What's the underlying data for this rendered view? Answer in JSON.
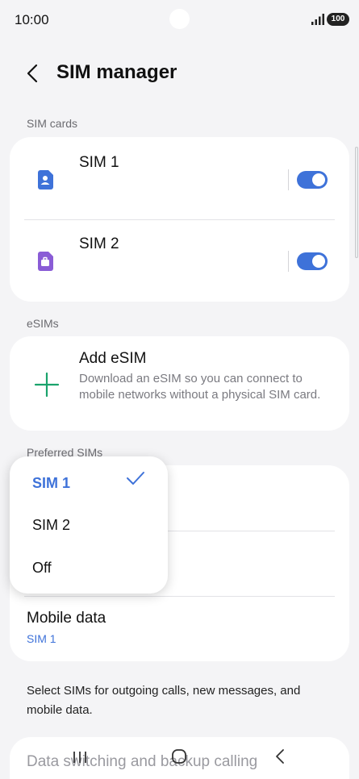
{
  "status_bar": {
    "time": "10:00",
    "battery": "100"
  },
  "header": {
    "title": "SIM manager"
  },
  "sections": {
    "sim_cards": "SIM cards",
    "esims": "eSIMs",
    "preferred": "Preferred SIMs"
  },
  "sim_cards": [
    {
      "name": "SIM 1",
      "enabled": true,
      "icon": "sim-card-person-icon",
      "color": "#3e72d9"
    },
    {
      "name": "SIM 2",
      "enabled": true,
      "icon": "sim-card-briefcase-icon",
      "color": "#8a5cd6"
    }
  ],
  "add_esim": {
    "title": "Add eSIM",
    "description": "Download an eSIM so you can connect to mobile networks without a physical SIM card.",
    "icon": "plus-icon",
    "color": "#1aa36c"
  },
  "preferred_sims": {
    "mobile_data": {
      "title": "Mobile data",
      "value": "SIM 1"
    }
  },
  "footnote": "Select SIMs for outgoing calls, new messages, and mobile data.",
  "dropdown": {
    "options": [
      "SIM 1",
      "SIM 2",
      "Off"
    ],
    "selected": "SIM 1",
    "icon": "check-icon"
  },
  "next_section": {
    "title": "Data switching and backup calling"
  },
  "accent_color": "#3e72d9"
}
